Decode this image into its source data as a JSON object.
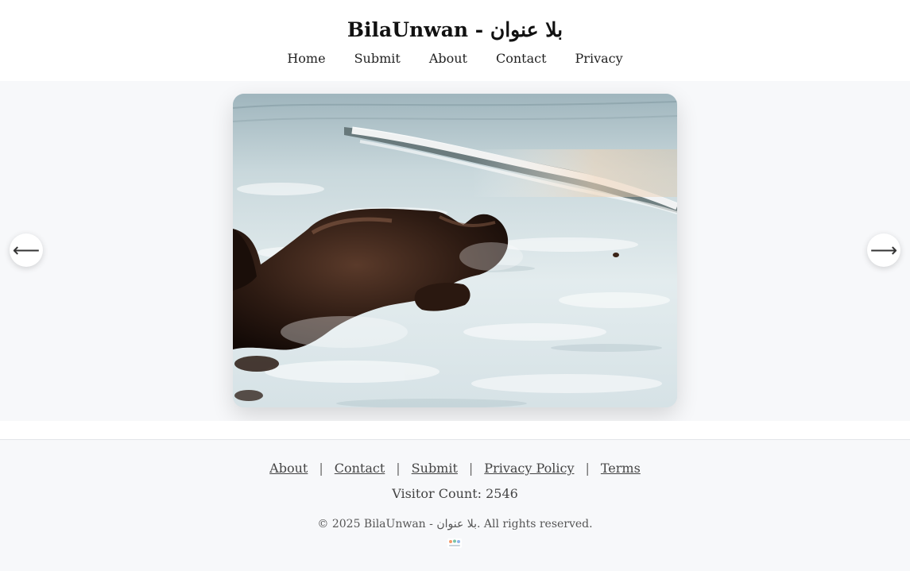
{
  "header": {
    "title": "BilaUnwan - بلا عنوان",
    "nav": [
      "Home",
      "Submit",
      "About",
      "Contact",
      "Privacy"
    ]
  },
  "carousel": {
    "prev_icon": "arrow-left-icon",
    "next_icon": "arrow-right-icon",
    "prev_glyph": "⟵",
    "next_glyph": "⟶",
    "slide_image": "ocean-waves-rocks-photo"
  },
  "footer": {
    "links": [
      "About",
      "Contact",
      "Submit",
      "Privacy Policy",
      "Terms"
    ],
    "separator": "|",
    "visitor_count": "Visitor Count: 2546",
    "copyright": "© 2025 BilaUnwan - بلا عنوان. All rights reserved.",
    "badge_icon": "counter-badge-icon"
  },
  "colors": {
    "page_background": "#f7f8fa",
    "header_background": "#ffffff"
  }
}
